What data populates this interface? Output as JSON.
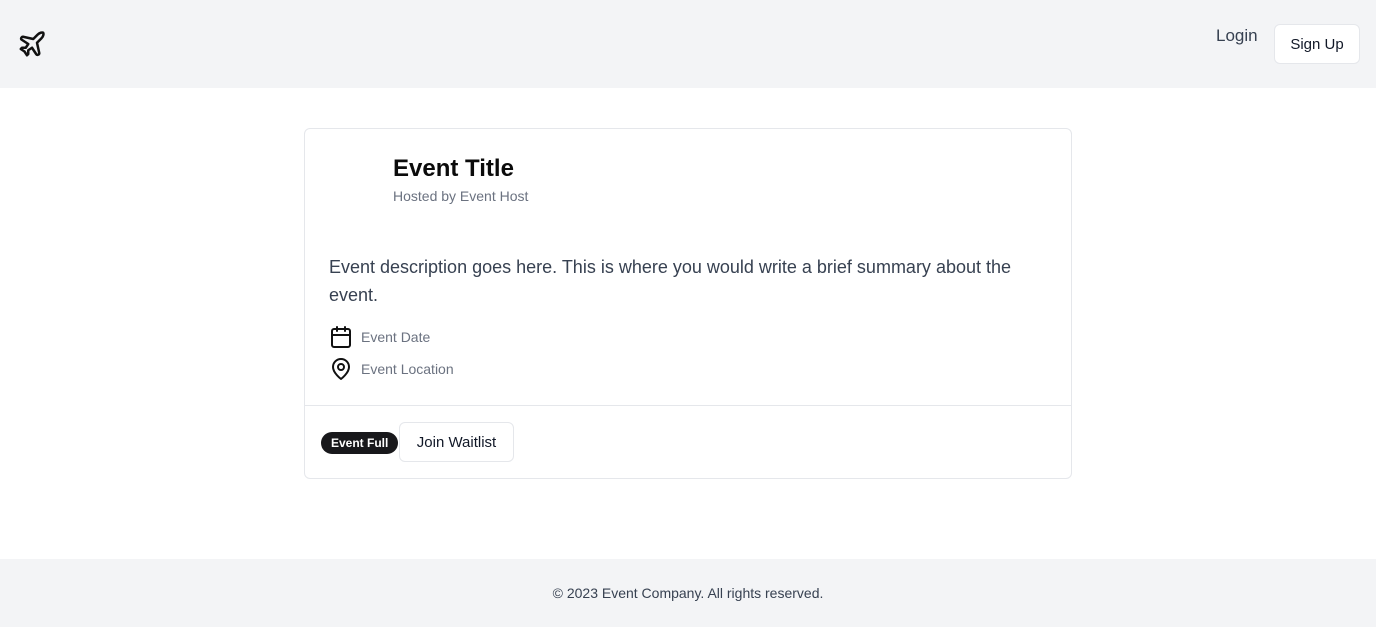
{
  "header": {
    "logo_icon": "plane-icon",
    "login_label": "Login",
    "signup_label": "Sign Up"
  },
  "event": {
    "title": "Event Title",
    "host": "Hosted by Event Host",
    "description": "Event description goes here. This is where you would write a brief summary about the event.",
    "date_icon": "calendar-icon",
    "date": "Event Date",
    "location_icon": "map-pin-icon",
    "location": "Event Location",
    "status_badge": "Event Full",
    "waitlist_label": "Join Waitlist"
  },
  "footer": {
    "text": "© 2023 Event Company. All rights reserved."
  },
  "colors": {
    "header_bg": "#f3f4f6",
    "badge_bg": "#18181b",
    "muted_text": "#6b7280"
  }
}
